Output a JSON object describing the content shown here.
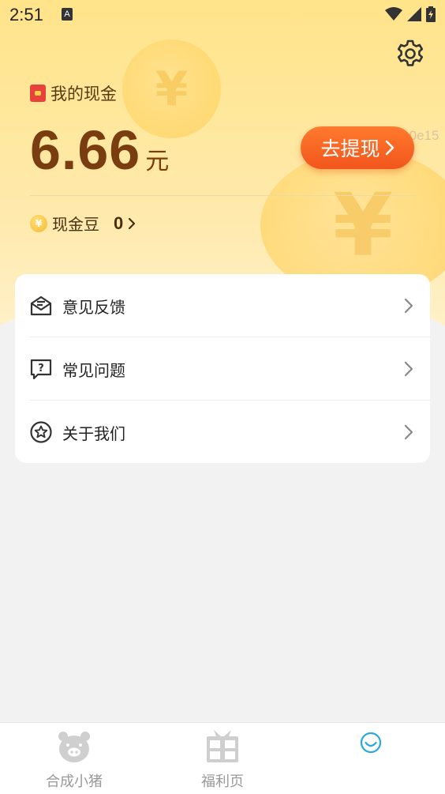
{
  "status_bar": {
    "time": "2:51",
    "notification_icon": "A"
  },
  "header": {
    "cash_label": "我的现金",
    "amount": "6.66",
    "amount_unit": "元",
    "withdraw_label": "去提现",
    "id_watermark": "ID:1a0e15",
    "beans_label": "现金豆",
    "beans_value": "0"
  },
  "menu": {
    "items": [
      {
        "label": "意见反馈",
        "icon": "envelope-icon"
      },
      {
        "label": "常见问题",
        "icon": "question-bubble-icon"
      },
      {
        "label": "关于我们",
        "icon": "star-circle-icon"
      }
    ]
  },
  "tabs": [
    {
      "label": "合成小猪",
      "icon": "pig-icon",
      "active": false
    },
    {
      "label": "福利页",
      "icon": "gift-icon",
      "active": false
    },
    {
      "label": "",
      "icon": "smile-icon",
      "active": true
    }
  ],
  "colors": {
    "accent": "#f2551c",
    "amount": "#7a3d10",
    "active_tab": "#29a8e0"
  }
}
